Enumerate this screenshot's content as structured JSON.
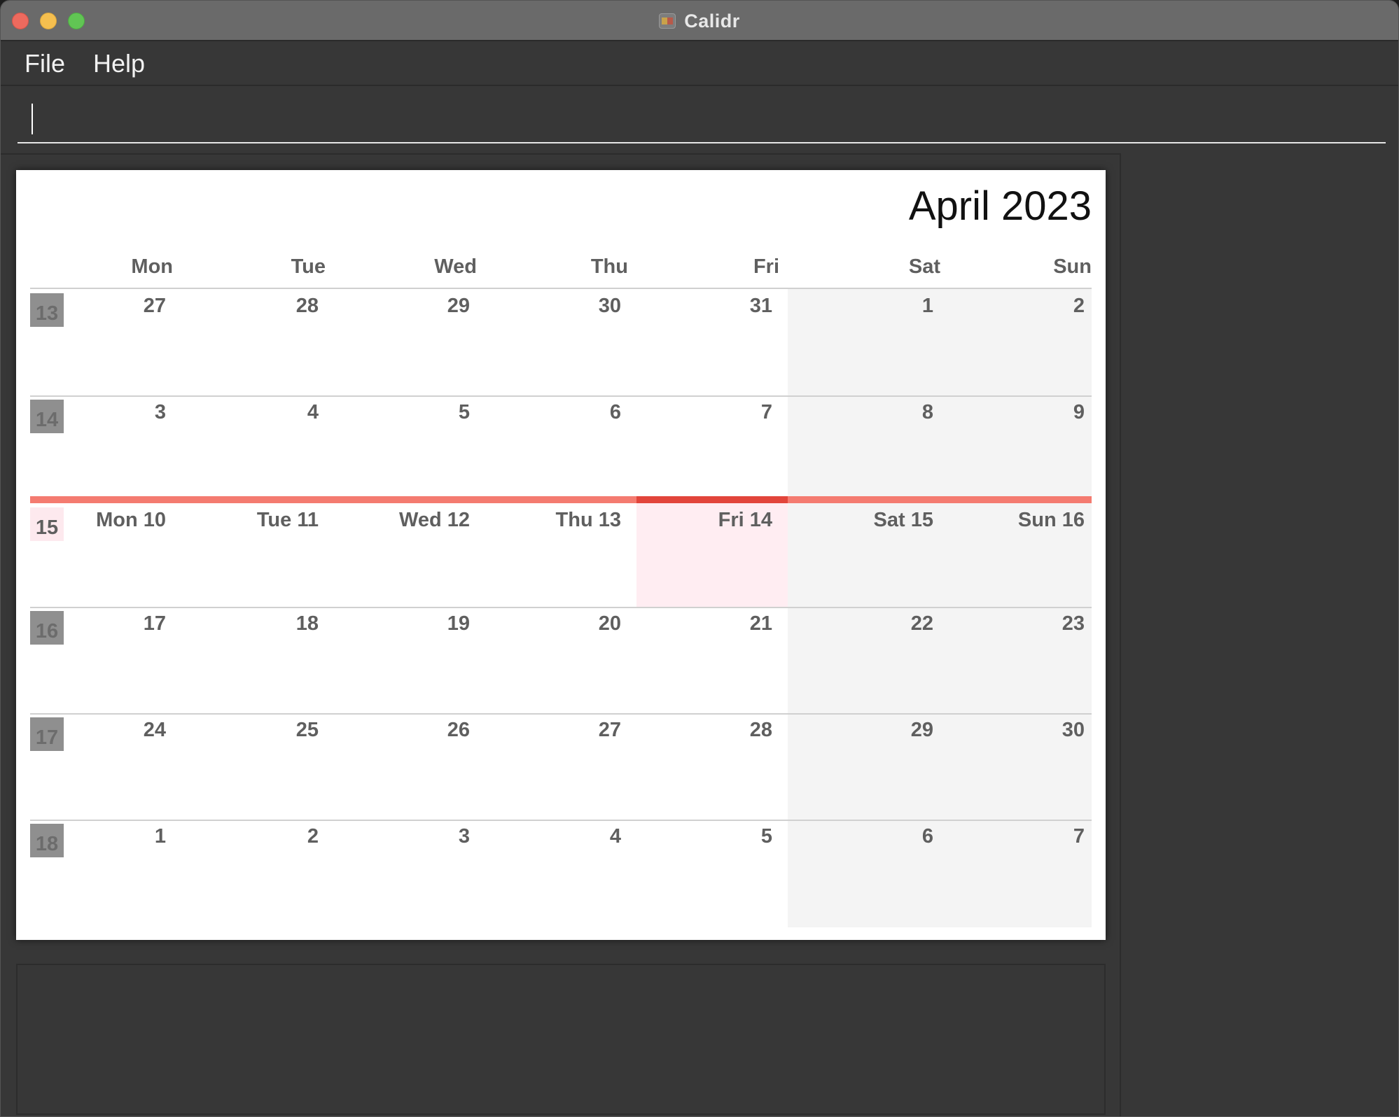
{
  "window": {
    "title": "Calidr"
  },
  "menu": {
    "file": "File",
    "help": "Help"
  },
  "command": {
    "value": "",
    "placeholder": ""
  },
  "calendar": {
    "month_title": "April 2023",
    "weekdays": [
      "Mon",
      "Tue",
      "Wed",
      "Thu",
      "Fri",
      "Sat",
      "Sun"
    ],
    "weeks": [
      {
        "number": "13",
        "days": [
          "27",
          "28",
          "29",
          "30",
          "31",
          "1",
          "2"
        ]
      },
      {
        "number": "14",
        "days": [
          "3",
          "4",
          "5",
          "6",
          "7",
          "8",
          "9"
        ]
      },
      {
        "number": "15",
        "current": true,
        "days": [
          "Mon 10",
          "Tue 11",
          "Wed 12",
          "Thu 13",
          "Fri 14",
          "Sat 15",
          "Sun 16"
        ]
      },
      {
        "number": "16",
        "days": [
          "17",
          "18",
          "19",
          "20",
          "21",
          "22",
          "23"
        ]
      },
      {
        "number": "17",
        "days": [
          "24",
          "25",
          "26",
          "27",
          "28",
          "29",
          "30"
        ]
      },
      {
        "number": "18",
        "days": [
          "1",
          "2",
          "3",
          "4",
          "5",
          "6",
          "7"
        ]
      }
    ],
    "today": "Fri 14"
  },
  "colors": {
    "current_week_bar": "#f47b70",
    "today_bar": "#e2453b",
    "today_cell": "#ffedf2",
    "weekend_cell": "#f4f4f4"
  },
  "result": {
    "text": ""
  }
}
